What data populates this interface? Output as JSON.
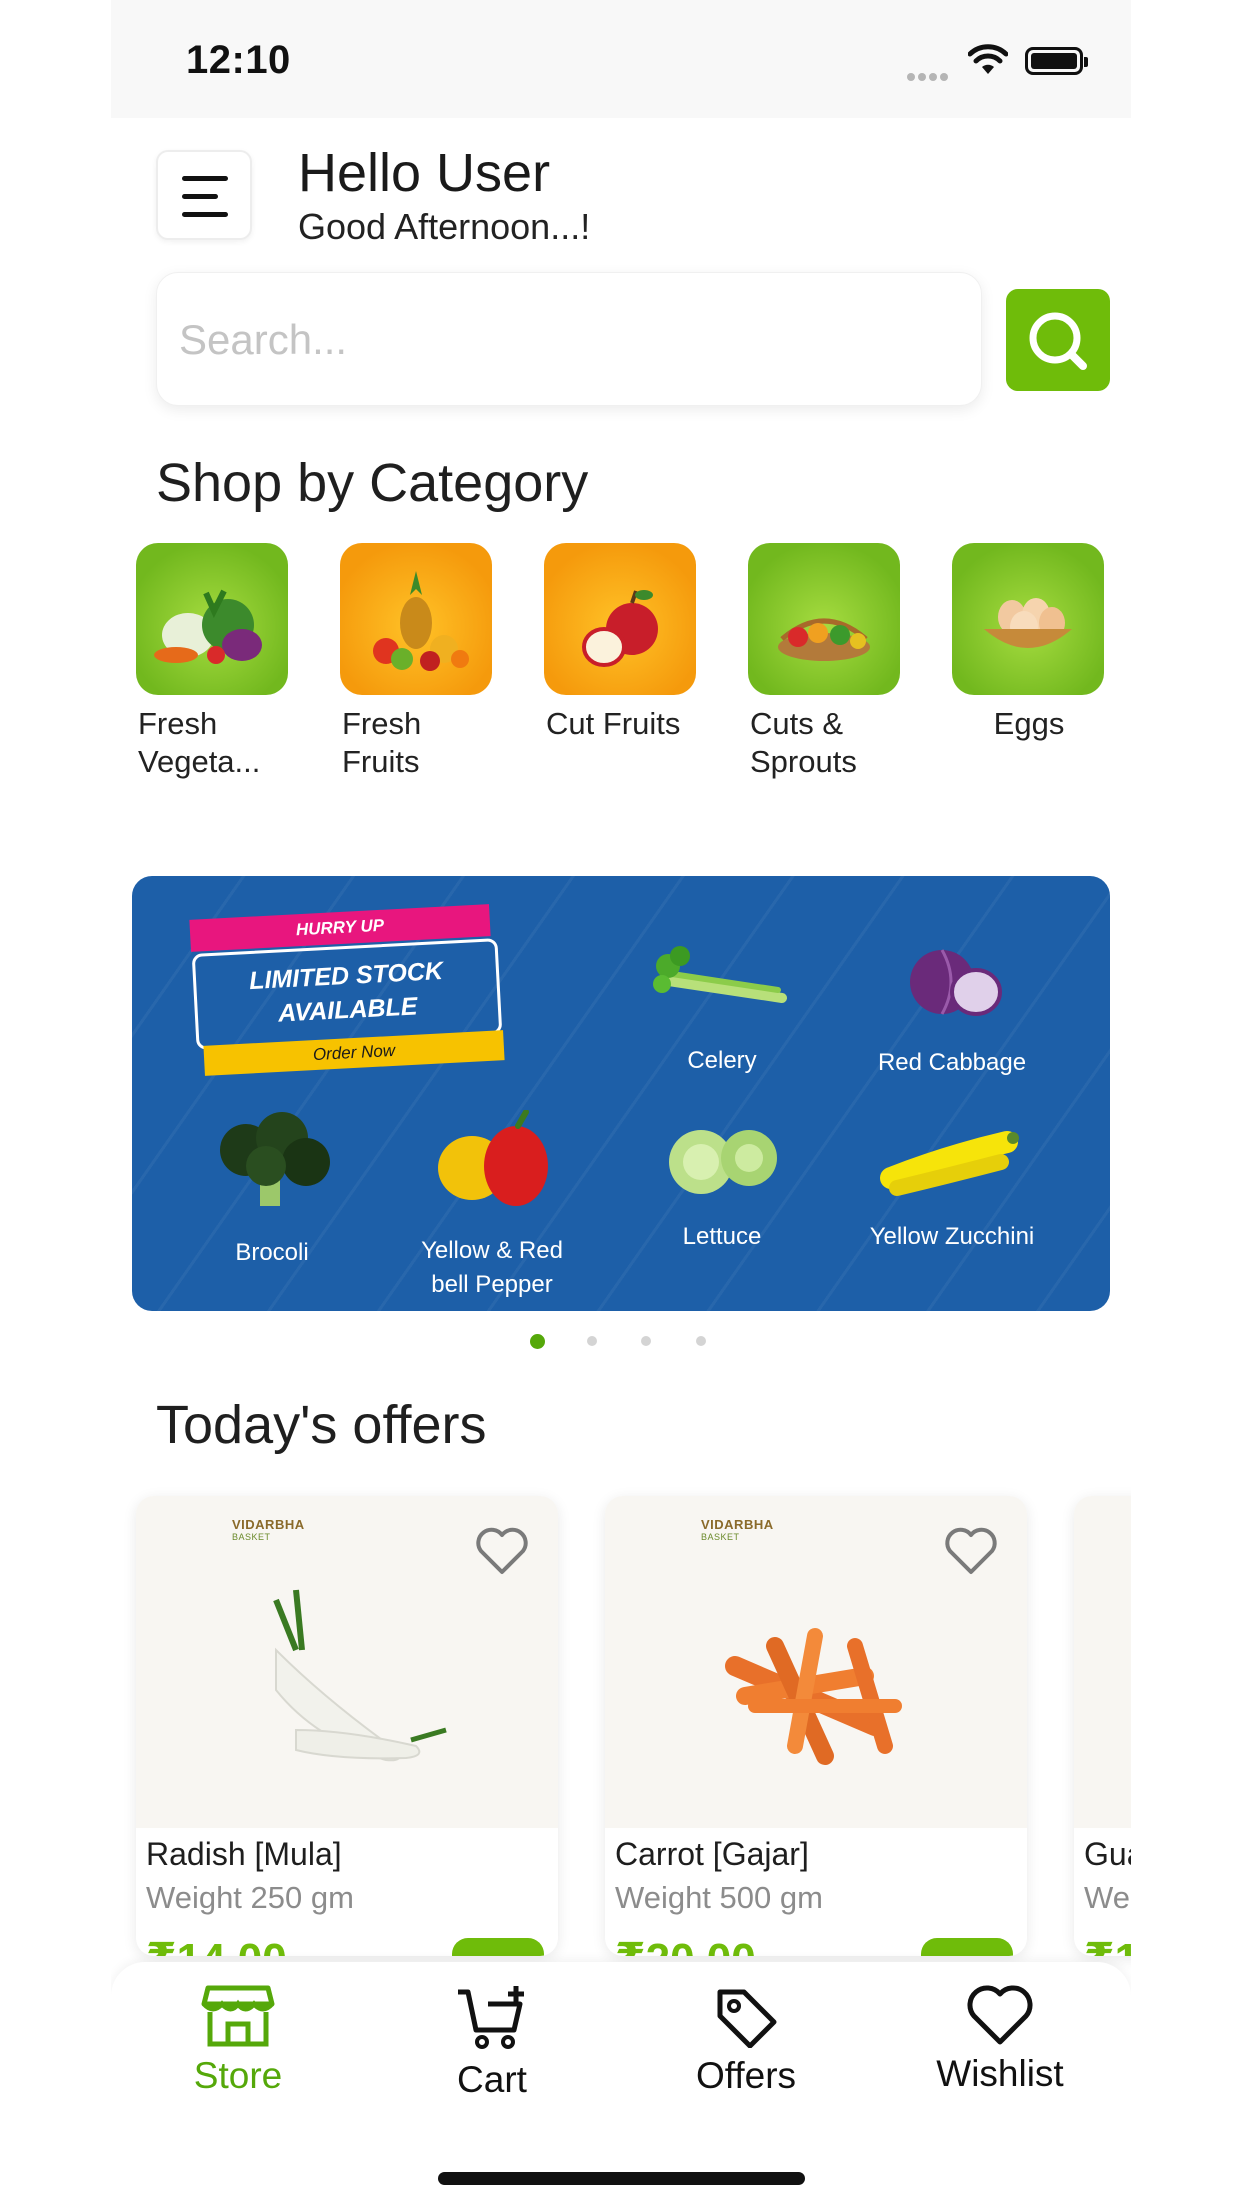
{
  "status_bar": {
    "time": "12:10"
  },
  "header": {
    "title": "Hello User",
    "subtitle": "Good Afternoon...!"
  },
  "search": {
    "placeholder": "Search..."
  },
  "categories": {
    "title": "Shop by Category",
    "items": [
      {
        "label": "Fresh Vegeta...",
        "tile_color": "#7cc022",
        "icon": "vegetables-icon"
      },
      {
        "label": "Fresh Fruits",
        "tile_color": "#f6a10d",
        "icon": "fruits-icon"
      },
      {
        "label": "Cut Fruits",
        "tile_color": "#f6a10d",
        "icon": "cut-apple-icon"
      },
      {
        "label": "Cuts & Sprouts",
        "tile_color": "#7cc022",
        "icon": "sprouts-basket-icon"
      },
      {
        "label": "Eggs",
        "tile_color": "#7cc022",
        "icon": "eggs-basket-icon"
      }
    ]
  },
  "banner": {
    "tag": "HURRY UP",
    "headline_1": "LIMITED STOCK",
    "headline_2": "AVAILABLE",
    "cta": "Order Now",
    "items": [
      {
        "label": "Celery",
        "icon": "celery-icon"
      },
      {
        "label": "Red Cabbage",
        "icon": "red-cabbage-icon"
      },
      {
        "label": "Brocoli",
        "icon": "broccoli-icon"
      },
      {
        "label_1": "Yellow & Red",
        "label_2": "bell Pepper",
        "icon": "bell-pepper-icon"
      },
      {
        "label": "Lettuce",
        "icon": "lettuce-icon"
      },
      {
        "label": "Yellow Zucchini",
        "icon": "zucchini-icon"
      }
    ],
    "page_count": 4,
    "active_page": 1,
    "background_color": "#1d5fa8"
  },
  "offers": {
    "title": "Today's offers",
    "products": [
      {
        "brand": "VIDARBHA",
        "brand_sub": "BASKET",
        "name": "Radish [Mula]",
        "weight": "Weight 250 gm",
        "price": "₹14.00"
      },
      {
        "brand": "VIDARBHA",
        "brand_sub": "BASKET",
        "name": "Carrot [Gajar]",
        "weight": "Weight 500 gm",
        "price": "₹20.00"
      },
      {
        "name": "Gua",
        "weight": "Wei",
        "price": "₹1"
      }
    ]
  },
  "bottom_nav": {
    "items": [
      {
        "label": "Store",
        "icon": "store-icon",
        "active": true
      },
      {
        "label": "Cart",
        "icon": "cart-plus-icon",
        "active": false
      },
      {
        "label": "Offers",
        "icon": "tag-icon",
        "active": false
      },
      {
        "label": "Wishlist",
        "icon": "heart-icon",
        "active": false
      }
    ]
  },
  "colors": {
    "accent": "#6fbc0a",
    "accent_dark": "#55a80a",
    "text": "#1f1f1f",
    "muted": "#8c8c8c"
  }
}
